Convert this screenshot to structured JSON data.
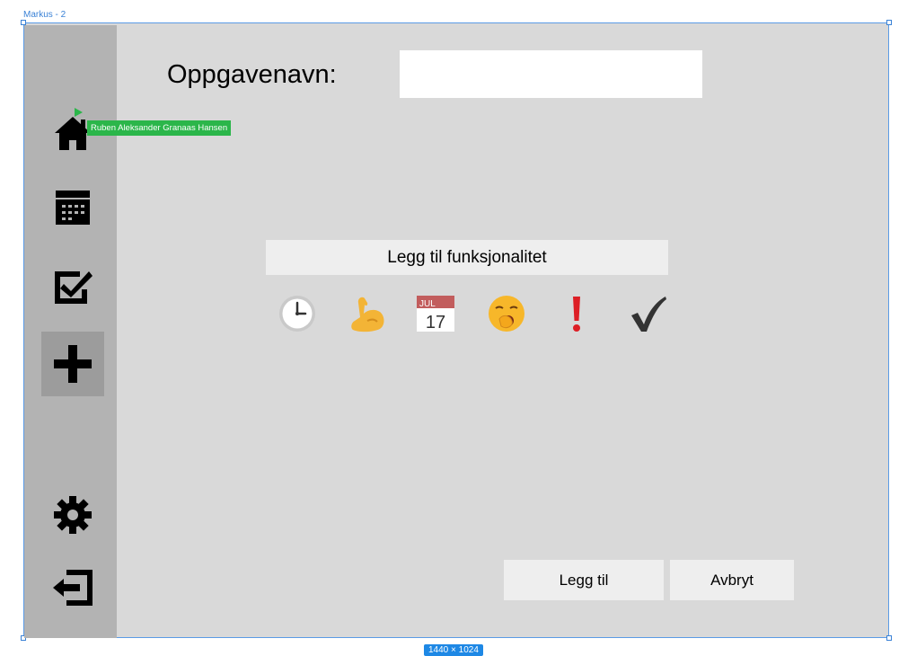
{
  "frame": {
    "label": "Markus - 2",
    "dimensions": "1440 × 1024"
  },
  "sidebar": {
    "items": [
      {
        "name": "home",
        "icon": "home-icon"
      },
      {
        "name": "calendar",
        "icon": "calendar-icon"
      },
      {
        "name": "tasks",
        "icon": "checkbox-icon"
      },
      {
        "name": "add",
        "icon": "plus-icon",
        "active": true
      },
      {
        "name": "settings",
        "icon": "gear-icon"
      },
      {
        "name": "logout",
        "icon": "logout-icon"
      }
    ]
  },
  "form": {
    "title_label": "Oppgavenavn:",
    "name_value": "",
    "name_placeholder": ""
  },
  "collaborator": {
    "name": "Ruben Aleksander Granaas Hansen",
    "color": "#2bb64a"
  },
  "features": {
    "add_label": "Legg til funksjonalitet",
    "calendar_month": "JUL",
    "calendar_day": "17",
    "icons": [
      "clock-icon",
      "flexed-biceps-icon",
      "calendar-date-icon",
      "yawning-face-icon",
      "exclamation-icon",
      "checkmark-icon"
    ]
  },
  "actions": {
    "add_label": "Legg til",
    "cancel_label": "Avbryt"
  },
  "colors": {
    "canvas": "#d9d9d9",
    "sidebar": "#b3b3b3",
    "active_nav": "#9c9c9c",
    "selection": "#3b82d6"
  }
}
